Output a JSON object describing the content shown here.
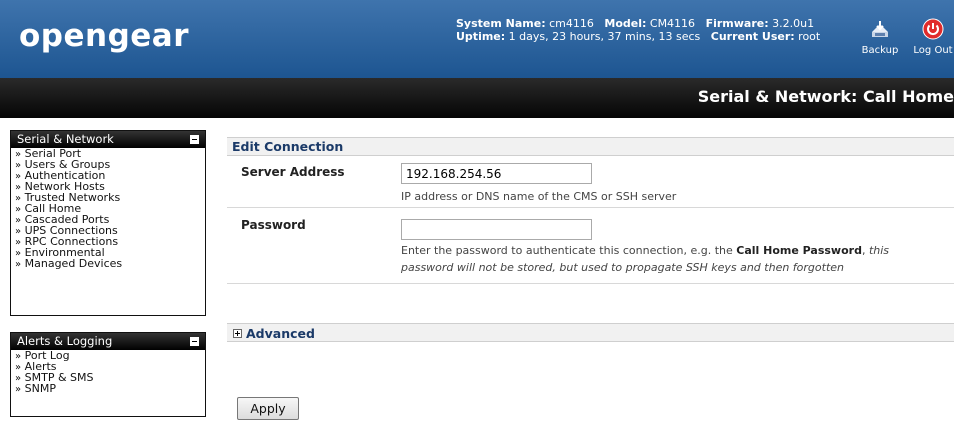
{
  "header": {
    "logo": "opengear",
    "system_name_label": "System Name:",
    "system_name": "cm4116",
    "model_label": "Model:",
    "model": "CM4116",
    "firmware_label": "Firmware:",
    "firmware": "3.2.0u1",
    "uptime_label": "Uptime:",
    "uptime": "1 days, 23 hours, 37 mins, 13 secs",
    "user_label": "Current User:",
    "user": "root",
    "backup_label": "Backup",
    "logout_label": "Log Out",
    "accent": "#1d5591"
  },
  "page_title": "Serial & Network: Call Home",
  "sidebar": {
    "serial_network": {
      "title": "Serial & Network",
      "items": [
        "Serial Port",
        "Users & Groups",
        "Authentication",
        "Network Hosts",
        "Trusted Networks",
        "Call Home",
        "Cascaded Ports",
        "UPS Connections",
        "RPC Connections",
        "Environmental",
        "Managed Devices"
      ]
    },
    "alerts_logging": {
      "title": "Alerts & Logging",
      "items": [
        "Port Log",
        "Alerts",
        "SMTP & SMS",
        "SNMP"
      ]
    },
    "bullet": "»"
  },
  "form": {
    "section_title": "Edit Connection",
    "server_address": {
      "label": "Server Address",
      "value": "192.168.254.56",
      "help": "IP address or DNS name of the CMS or SSH server"
    },
    "password": {
      "label": "Password",
      "value": "",
      "help_prefix": "Enter the password to authenticate this connection, e.g. the ",
      "help_bold": "Call Home Password",
      "help_sep": ", ",
      "help_italic": "this password will not be stored, but used to propagate SSH keys and then forgotten"
    },
    "advanced_title": "Advanced",
    "apply_label": "Apply"
  }
}
